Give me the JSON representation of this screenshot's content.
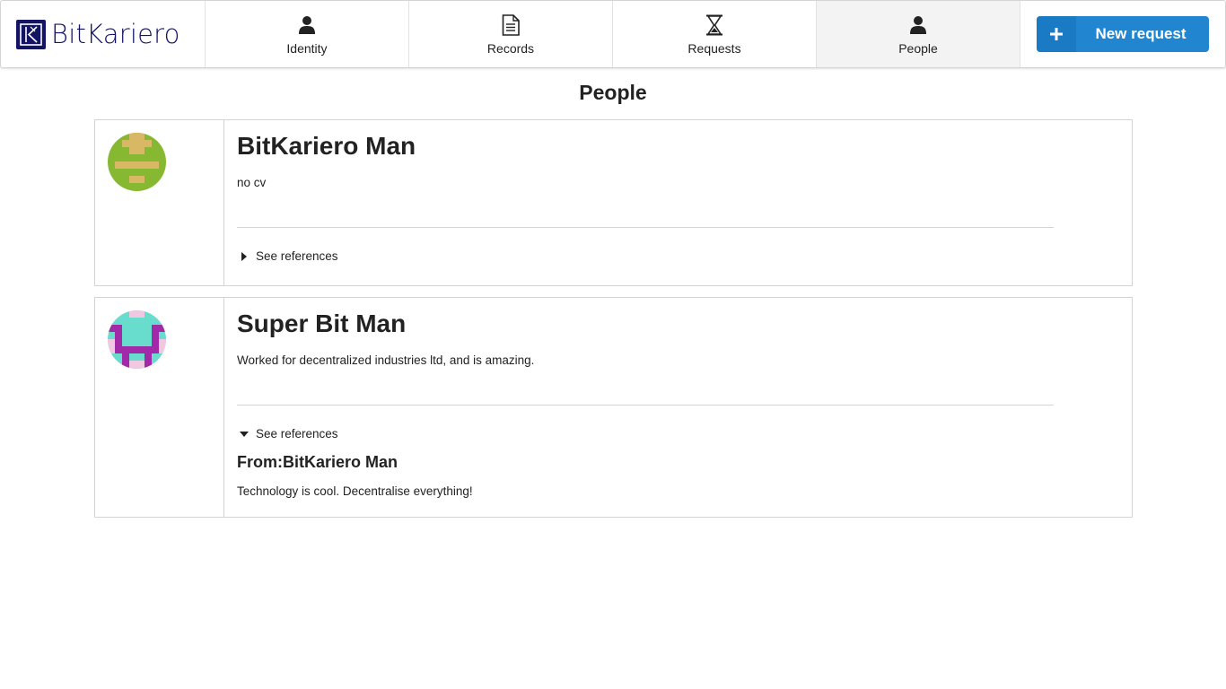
{
  "brand": {
    "name": "BitKariero",
    "color": "#141464"
  },
  "nav": {
    "items": [
      {
        "label": "Identity",
        "icon": "user-icon",
        "active": false
      },
      {
        "label": "Records",
        "icon": "document-icon",
        "active": false
      },
      {
        "label": "Requests",
        "icon": "hourglass-icon",
        "active": false
      },
      {
        "label": "People",
        "icon": "user-icon",
        "active": true
      }
    ],
    "new_button": {
      "label": "New request",
      "icon": "plus-icon",
      "color": "#2185d0"
    }
  },
  "page": {
    "title": "People"
  },
  "people": [
    {
      "name": "BitKariero Man",
      "description": "no cv",
      "refs_label": "See references",
      "refs_expanded": false,
      "references": []
    },
    {
      "name": "Super Bit Man",
      "description": "Worked for decentralized industries ltd, and is amazing.",
      "refs_label": "See references",
      "refs_expanded": true,
      "references": [
        {
          "from": "From:BitKariero Man",
          "text": "Technology is cool. Decentralise everything!"
        }
      ]
    }
  ]
}
